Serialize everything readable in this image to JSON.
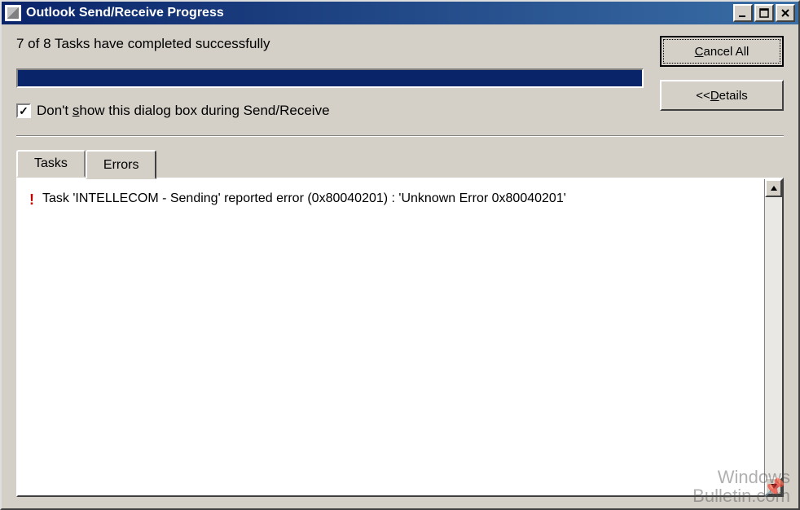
{
  "title": "Outlook Send/Receive Progress",
  "status_text": "7 of 8 Tasks have completed successfully",
  "checkbox": {
    "checked": true,
    "label_pre": "Don't ",
    "label_u": "s",
    "label_post": "how this dialog box during Send/Receive"
  },
  "buttons": {
    "cancel_pre": "",
    "cancel_u": "C",
    "cancel_post": "ancel All",
    "details_pre": "<< ",
    "details_u": "D",
    "details_post": "etails"
  },
  "tabs": {
    "tasks": "Tasks",
    "errors": "Errors"
  },
  "errors": [
    {
      "text": "Task 'INTELLECOM - Sending' reported error (0x80040201) : 'Unknown Error 0x80040201'"
    }
  ],
  "watermark_line1": "Windows",
  "watermark_line2": "Bulletin.com"
}
